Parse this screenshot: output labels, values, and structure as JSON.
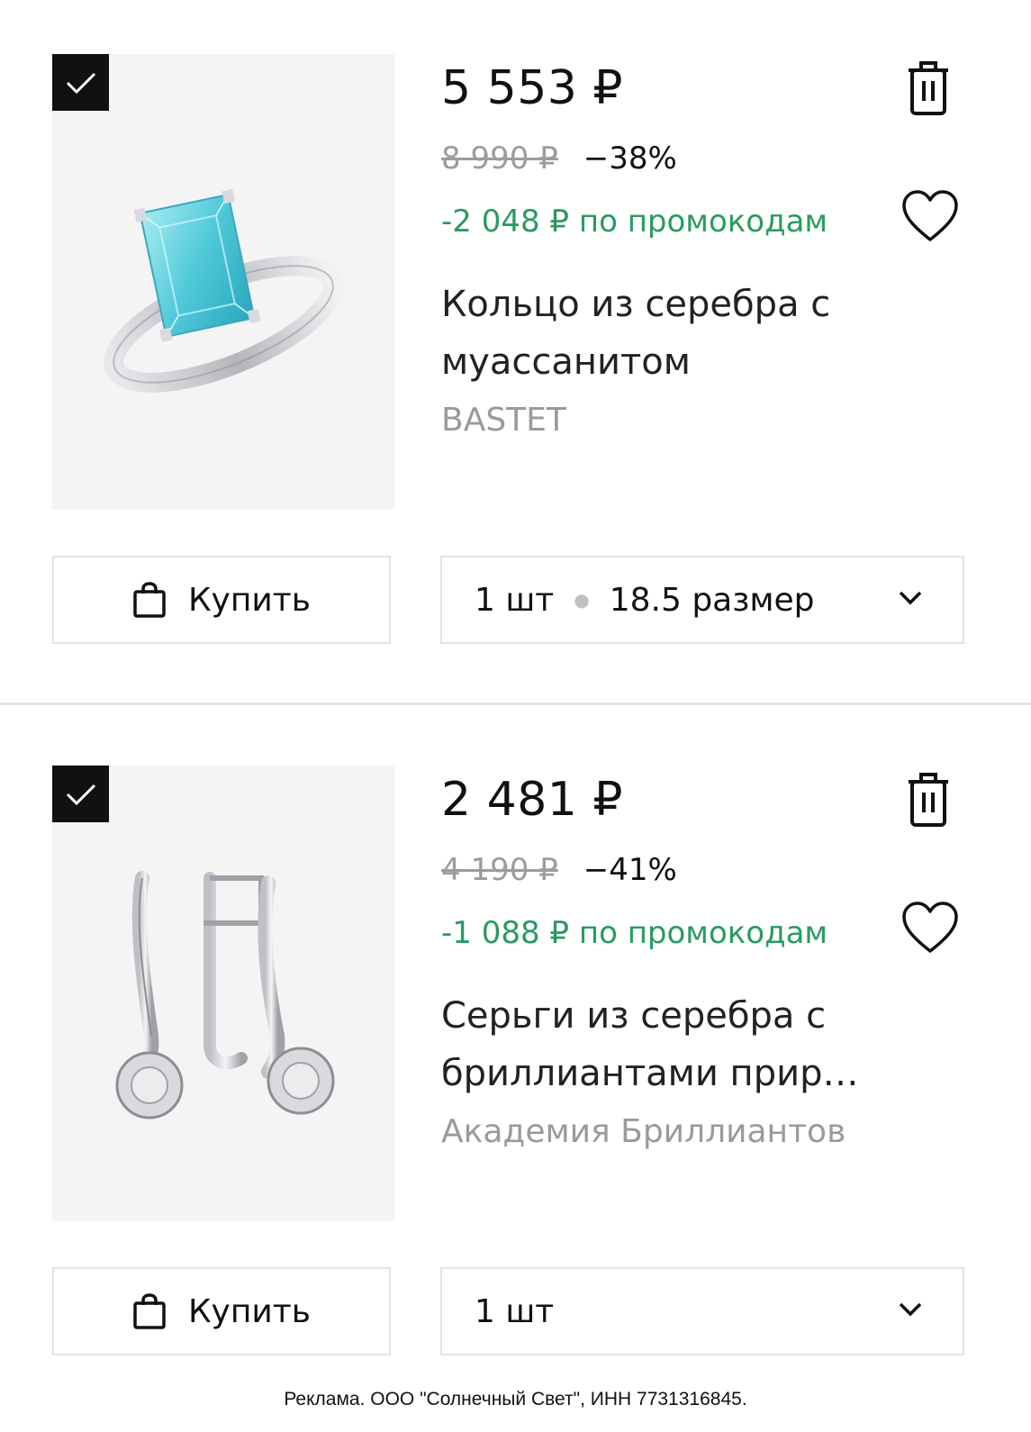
{
  "items": [
    {
      "price": "5 553 ₽",
      "old_price": "8 990 ₽",
      "discount": "−38%",
      "promo": "-2 048 ₽ по промокодам",
      "title": "Кольцо из серебра с муассанитом",
      "brand": "BASTET",
      "buy_label": "Купить",
      "quantity": "1 шт",
      "size": "18.5 размер",
      "image": "ring-with-blue-stone",
      "selected": true
    },
    {
      "price": "2 481 ₽",
      "old_price": "4 190 ₽",
      "discount": "−41%",
      "promo": "-1 088 ₽ по промокодам",
      "title": "Серьги из серебра с бриллиантами прир…",
      "brand": "Академия Бриллиантов",
      "buy_label": "Купить",
      "quantity": "1 шт",
      "image": "silver-earrings-with-diamonds",
      "selected": true
    }
  ],
  "footer": {
    "ad_text": "Реклама. ООО \"Солнечный Свет\", ИНН 7731316845."
  },
  "colors": {
    "promo_green": "#2a9a62",
    "old_price_gray": "#9c9c9c",
    "checkbox_black": "#111111"
  },
  "icons": [
    "check-icon",
    "trash-icon",
    "heart-icon",
    "shopping-bag-icon",
    "chevron-down-icon"
  ]
}
